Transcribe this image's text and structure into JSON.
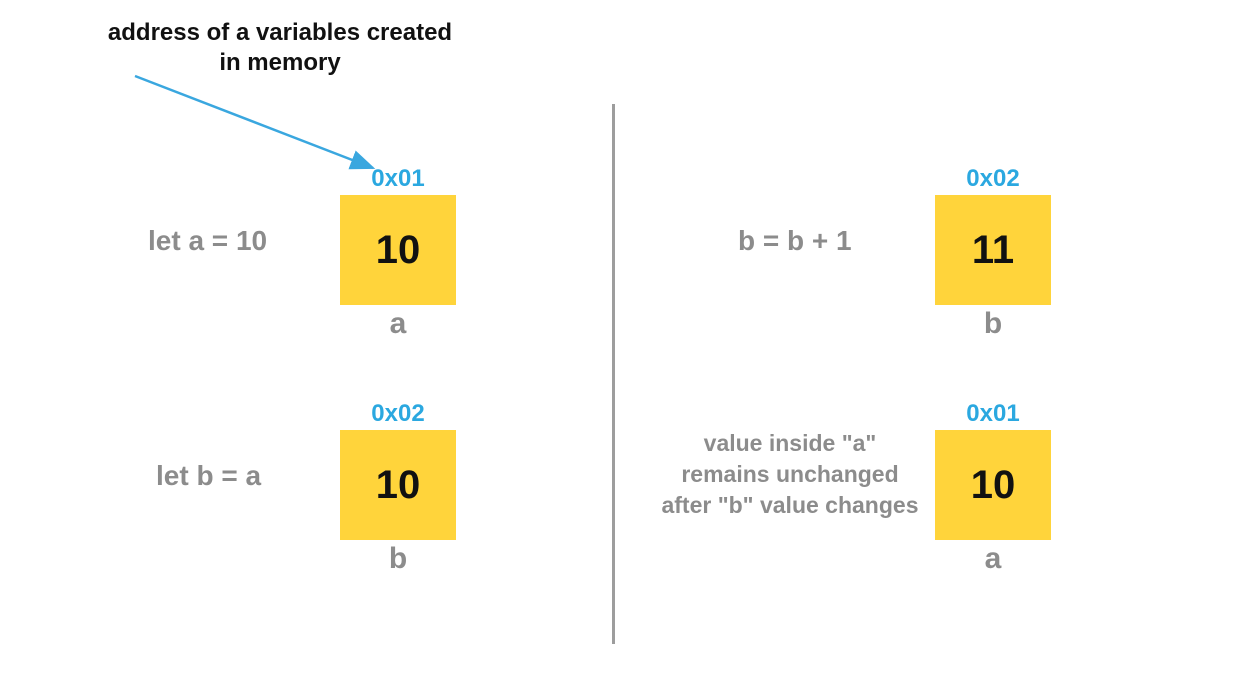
{
  "annotation": {
    "line1": "address of a variables created",
    "line2": "in memory"
  },
  "colors": {
    "arrow": "#3aa7df",
    "address": "#2ba8e0",
    "box": "#ffd43b",
    "code": "#8c8c8c",
    "title": "#111111"
  },
  "left": {
    "top": {
      "code": "let a = 10",
      "address": "0x01",
      "value": "10",
      "name": "a"
    },
    "bottom": {
      "code": "let b = a",
      "address": "0x02",
      "value": "10",
      "name": "b"
    }
  },
  "right": {
    "top": {
      "code": "b = b + 1",
      "address": "0x02",
      "value": "11",
      "name": "b"
    },
    "bottom": {
      "note_line1": "value inside \"a\"",
      "note_line2": "remains unchanged",
      "note_line3": "after \"b\" value changes",
      "address": "0x01",
      "value": "10",
      "name": "a"
    }
  }
}
